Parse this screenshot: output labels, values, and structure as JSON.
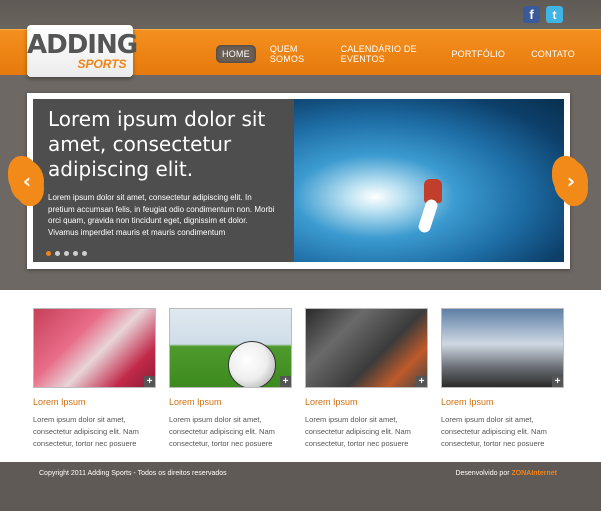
{
  "social": {
    "facebook": "f",
    "twitter": "t"
  },
  "logo": {
    "line1": "ADDING",
    "line2": "SPORTS"
  },
  "nav": [
    "HOME",
    "QUEM SOMOS",
    "CALENDÁRIO DE EVENTOS",
    "PORTFÓLIO",
    "CONTATO"
  ],
  "slider": {
    "title": "Lorem ipsum dolor sit amet, consectetur adipiscing elit.",
    "body": "Lorem ipsum dolor sit amet, consectetur adipiscing elit. In pretium accumsan felis, in feugiat odio condimentum non. Morbi orci quam, gravida non tincidunt eget, dignissim et dolor. Vivamus imperdiet mauris et mauris condimentum",
    "prev_glyph": "‹",
    "next_glyph": "›",
    "slide_count": 5,
    "active_slide": 1
  },
  "cards": [
    {
      "title": "Lorem Ipsum",
      "text": "Lorem ipsum dolor sit amet, consectetur adipiscing elit. Nam consectetur, tortor nec posuere",
      "plus": "+"
    },
    {
      "title": "Lorem Ipsum",
      "text": "Lorem ipsum dolor sit amet, consectetur adipiscing elit. Nam consectetur, tortor nec posuere",
      "plus": "+"
    },
    {
      "title": "Lorem Ipsum",
      "text": "Lorem ipsum dolor sit amet, consectetur adipiscing elit. Nam consectetur, tortor nec posuere",
      "plus": "+"
    },
    {
      "title": "Lorem Ipsum",
      "text": "Lorem ipsum dolor sit amet, consectetur adipiscing elit. Nam consectetur, tortor nec posuere",
      "plus": "+"
    }
  ],
  "footer": {
    "copyright": "Copyright 2011 Adding Sports - Todos os direitos reservados",
    "dev_label": "Desenvolvido por",
    "dev_brand": "ZONAInternet"
  },
  "colors": {
    "accent": "#f08418",
    "nav_bg": "#ec820f",
    "footer_bg": "#5f5a55"
  }
}
